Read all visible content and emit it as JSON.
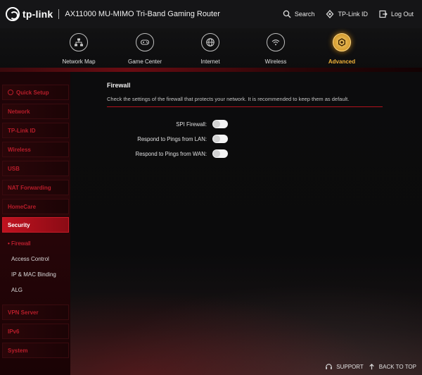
{
  "header": {
    "brand": "tp-link",
    "model": "AX11000 MU-MIMO Tri-Band Gaming Router",
    "actions": [
      {
        "label": "Search",
        "icon": "search-icon"
      },
      {
        "label": "TP-Link ID",
        "icon": "tplink-id-icon"
      },
      {
        "label": "Log Out",
        "icon": "logout-icon"
      }
    ]
  },
  "nav": {
    "items": [
      {
        "label": "Network Map",
        "icon": "network-map-icon"
      },
      {
        "label": "Game Center",
        "icon": "gamepad-icon"
      },
      {
        "label": "Internet",
        "icon": "globe-icon"
      },
      {
        "label": "Wireless",
        "icon": "wifi-icon"
      },
      {
        "label": "Advanced",
        "icon": "gear-icon",
        "active": true
      }
    ]
  },
  "sidebar": {
    "items": [
      {
        "label": "Quick Setup",
        "icon": "quick-setup-icon"
      },
      {
        "label": "Network"
      },
      {
        "label": "TP-Link ID"
      },
      {
        "label": "Wireless"
      },
      {
        "label": "USB"
      },
      {
        "label": "NAT Forwarding"
      },
      {
        "label": "HomeCare"
      },
      {
        "label": "Security",
        "active": true
      },
      {
        "label": "VPN Server"
      },
      {
        "label": "IPv6"
      },
      {
        "label": "System"
      }
    ],
    "sub_items": [
      {
        "label": "• Firewall",
        "active": true
      },
      {
        "label": "Access Control"
      },
      {
        "label": "IP & MAC Binding"
      },
      {
        "label": "ALG"
      }
    ]
  },
  "main": {
    "title": "Firewall",
    "description": "Check the settings of the firewall that protects your network. It is recommended to keep them as default.",
    "options": [
      {
        "label": "SPI Firewall:",
        "enabled": false
      },
      {
        "label": "Respond to Pings from LAN:",
        "enabled": false
      },
      {
        "label": "Respond to Pings from WAN:",
        "enabled": false
      }
    ]
  },
  "footer": {
    "support": "SUPPORT",
    "back": "BACK TO TOP"
  },
  "colors": {
    "accent_red": "#b81d2a",
    "accent_gold": "#f3b43a",
    "background": "#0b0b0c"
  }
}
